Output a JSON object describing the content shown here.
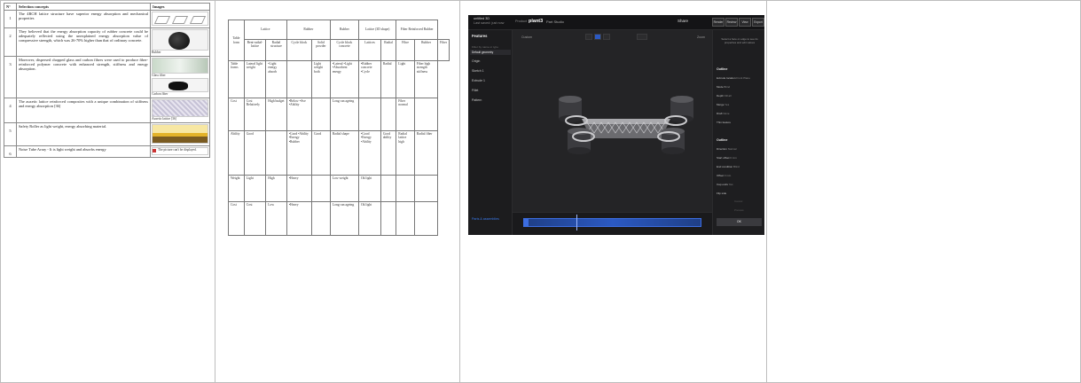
{
  "panel1": {
    "headers": [
      "N°",
      "Selection concepts",
      "Images"
    ],
    "rows": [
      {
        "no": "1",
        "text": "The 4RCH lattice structure have superior energy absorption and mechanical properties",
        "images": [
          {
            "kind": "lattice",
            "caption": ""
          }
        ]
      },
      {
        "no": "2",
        "text": "They believed that the energy absorption capacity of rubber concrete could be adequately reflected using the unexplained energy absorption value of compressive strength, which was 26-70% higher than that of ordinary concrete.",
        "images": [
          {
            "kind": "rubber",
            "caption": "Rubber"
          }
        ]
      },
      {
        "no": "3",
        "text": "Moreover, dispersed chopped glass and carbon fibres were used to produce fiber-reinforced polymer concrete with enhanced strength, stiffness and energy absorption.",
        "images": [
          {
            "kind": "glass",
            "caption": "Glass fiber"
          },
          {
            "kind": "carbon",
            "caption": "Carbon fiber"
          }
        ]
      },
      {
        "no": "4",
        "text": "The auxetic lattice reinforced composites with a unique combination of stiffness and energy absorption [36]",
        "images": [
          {
            "kind": "auxetic",
            "caption": "Auxetic lattice [36]"
          }
        ]
      },
      {
        "no": "5",
        "text": "Safety Roller as light weight, energy absorbing material.",
        "images": [
          {
            "kind": "barrier",
            "caption": ""
          }
        ]
      },
      {
        "no": "6",
        "text": "Noise Tube Array - It is light weight and absorbs energy",
        "images": [
          {
            "kind": "noimg",
            "caption": "The picture can't be displayed."
          }
        ]
      }
    ]
  },
  "panel2": {
    "group_headers": [
      "Table form",
      "Lattice",
      "Rubber",
      "Rubber",
      "Lattice (3D shape)",
      "Fiber Reinforced Rubber"
    ],
    "sub_headers": [
      "",
      "Bent-radial-lattice",
      "Radial structure",
      "Cycle block",
      "Solid powder",
      "Cycle block concrete",
      "Lattices",
      "Radial",
      "Fibre",
      "Rubber",
      "Fiber"
    ],
    "rows": [
      {
        "cells": [
          "Table forms",
          "Lateral light weight",
          "•Light energy absorb",
          "",
          "Light weight both",
          "•Lateral •Light •Absorbent energy",
          "•Rubber concrete •Cycle",
          "Radial",
          "Light",
          "Fiber high strength stiffness"
        ]
      },
      {
        "cells": [
          "Cost",
          "Cost Relatively",
          "High budget",
          "•Below •Ave •Ability",
          "",
          "Long run ageing",
          "",
          "",
          "Fiber normal",
          ""
        ]
      },
      {
        "cells": [
          "Ability",
          "Good",
          "",
          "•Good •Ability •Energy •Rubber",
          "Good",
          "Radial shape",
          "•Good •Energy •Ability",
          "Good ability",
          "Radial lattice high",
          "Radial fiber"
        ]
      },
      {
        "cells": [
          "Weight",
          "Light",
          "High",
          "•Heavy",
          "",
          "Low weight",
          "Ok light",
          "",
          "",
          ""
        ]
      },
      {
        "cells": [
          "Cost",
          "Cost",
          "Low",
          "•Heavy",
          "",
          "Long run ageing",
          "Ok light",
          "",
          "",
          ""
        ]
      }
    ]
  },
  "app": {
    "project_name": "untitled 3D",
    "project_sub": "Last saved: just now",
    "brand": "Product",
    "app_name": "plant3",
    "doc_name": "Part Studio",
    "share_label": "Share",
    "user_label": "SolidWorks",
    "toolbar_buttons": [
      "Render",
      "Review",
      "View",
      "Export"
    ],
    "left_title": "Features",
    "left_sub": "Filter by name or type",
    "selected_item": "Default geometry",
    "left_items": [
      "Origin",
      "Sketch 1",
      "Extrude 1",
      "Fillet",
      "Pattern"
    ],
    "left_footer": "Parts & assemblies",
    "view_filter": "Custom",
    "view_zoom": "Zoom",
    "right_message": "Select a face or edge to see its properties and edit values",
    "section_1": "Outline",
    "props_1": [
      {
        "k": "Extrude location",
        "v": "Front Plane"
      },
      {
        "k": "Mode",
        "v": "Blind"
      },
      {
        "k": "Depth",
        "v": "Fill all"
      },
      {
        "k": "Merge",
        "v": "Yes"
      },
      {
        "k": "Draft",
        "v": "None"
      },
      {
        "k": "Thin feature",
        "v": ""
      }
    ],
    "section_2": "Outline",
    "props_2": [
      {
        "k": "Direction",
        "v": "Normal"
      },
      {
        "k": "Start offset",
        "v": "0 mm"
      },
      {
        "k": "End condition",
        "v": "Blind"
      },
      {
        "k": "Offset",
        "v": "0 mm"
      },
      {
        "k": "Cap ends",
        "v": "Yes"
      },
      {
        "k": "Flip side",
        "v": ""
      }
    ],
    "ghost_1": "Cancel",
    "ghost_2": "Preview",
    "ok_label": "OK",
    "colors": {
      "accent": "#3c6de0",
      "bg": "#1c1c1e",
      "part": "#b8b8bc"
    }
  }
}
